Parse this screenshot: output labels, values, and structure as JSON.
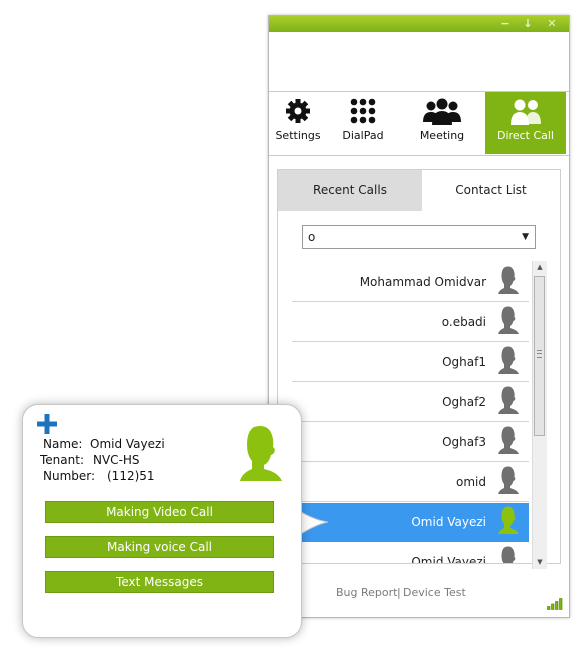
{
  "window": {
    "titlebar_controls": [
      "−",
      "↓",
      "✕"
    ]
  },
  "toolbar": {
    "items": [
      {
        "label": "Settings",
        "icon": "gear-icon"
      },
      {
        "label": "DialPad",
        "icon": "dialpad-icon"
      },
      {
        "label": "Meeting",
        "icon": "meeting-icon"
      },
      {
        "label": "Direct Call",
        "icon": "direct-call-icon",
        "active": true
      }
    ]
  },
  "tabs": [
    {
      "label": "Recent Calls",
      "active": false
    },
    {
      "label": "Contact List",
      "active": true
    }
  ],
  "search": {
    "value": "o"
  },
  "contacts": [
    {
      "name": "Mohammad Omidvar"
    },
    {
      "name": "o.ebadi"
    },
    {
      "name": "Oghaf1"
    },
    {
      "name": "Oghaf2"
    },
    {
      "name": "Oghaf3"
    },
    {
      "name": "omid"
    },
    {
      "name": "Omid Vayezi",
      "selected": true
    },
    {
      "name": "Omid Vayezi"
    }
  ],
  "footer": {
    "bug_report": "Bug Report",
    "separator": "|",
    "device_test": "Device Test"
  },
  "popup": {
    "name_label": "Name:",
    "name_value": "Omid Vayezi",
    "tenant_label": "Tenant:",
    "tenant_value": "NVC-HS",
    "number_label": "Number:",
    "number_value": "(112)51",
    "buttons": {
      "video": "Making Video Call",
      "voice": "Making voice Call",
      "text": "Text Messages"
    }
  },
  "colors": {
    "accent_green": "#80b414",
    "selection_blue": "#3a98ef",
    "avatar_gray": "#707070",
    "avatar_green": "#8cc10f",
    "plus_blue": "#1e73be"
  }
}
